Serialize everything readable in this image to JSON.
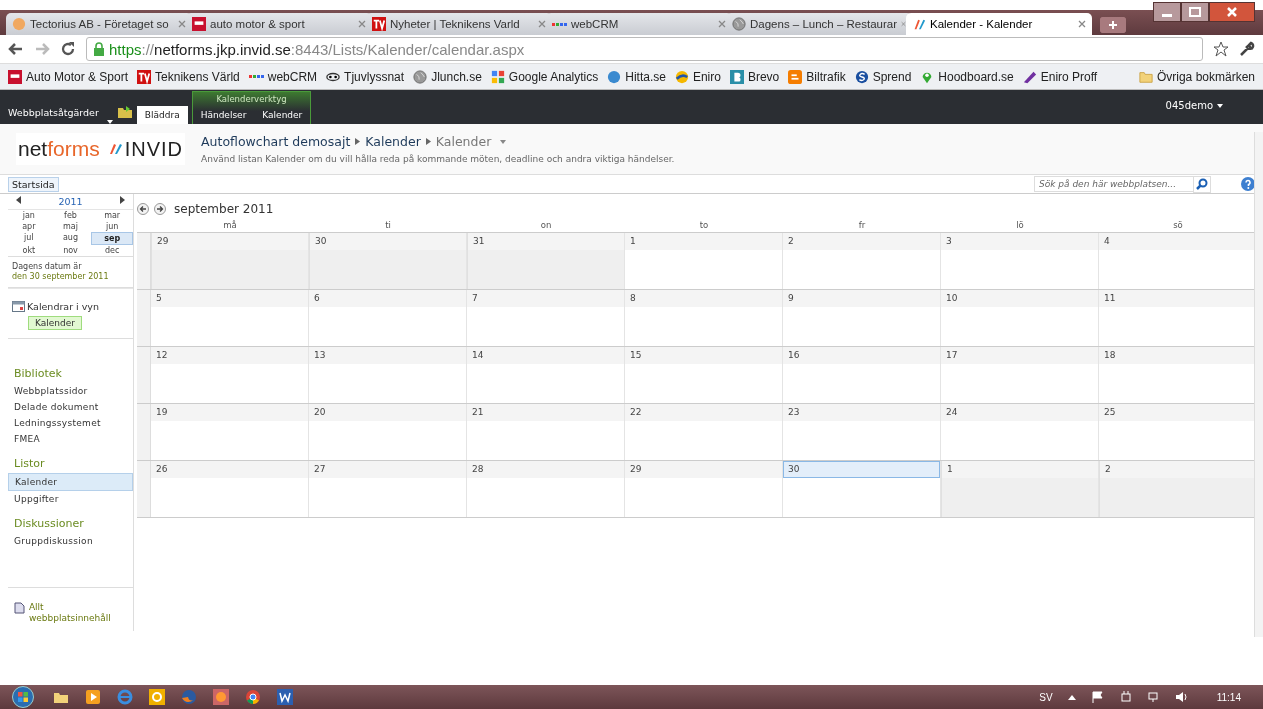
{
  "browser": {
    "tabs": [
      {
        "title": "Tectorius AB - Företaget so",
        "selected": false
      },
      {
        "title": "auto motor & sport",
        "selected": false
      },
      {
        "title": "Nyheter | Teknikens Varld",
        "selected": false
      },
      {
        "title": "webCRM",
        "selected": false
      },
      {
        "title": "Dagens – Lunch – Restaurar",
        "selected": false
      },
      {
        "title": "Kalender - Kalender",
        "selected": true
      }
    ],
    "url": {
      "scheme": "https",
      "rest": "://",
      "host": "netforms.jkp.invid.se",
      "path": ":8443/Lists/Kalender/calendar.aspx"
    },
    "bookmarks": [
      "Auto Motor & Sport",
      "Teknikens Värld",
      "webCRM",
      "Tjuvlyssnat",
      "Jlunch.se",
      "Google Analytics",
      "Hitta.se",
      "Eniro",
      "Brevo",
      "Biltrafik",
      "Sprend",
      "Hoodboard.se",
      "Eniro Proff"
    ],
    "other_bookmarks": "Övriga bokmärken"
  },
  "ribbon": {
    "site_actions": "Webbplatsåtgärder",
    "tabs": [
      {
        "label": "Bläddra",
        "selected": true
      }
    ],
    "tool_group": {
      "label": "Kalenderverktyg",
      "tabs": [
        {
          "label": "Händelser",
          "selected": false
        },
        {
          "label": "Kalender",
          "selected": false
        }
      ]
    },
    "user": "045demo"
  },
  "header": {
    "logo_dark": "net",
    "logo_accent": "forms",
    "logo_brand": "INVID",
    "breadcrumb": [
      "Autoflowchart demosajt",
      "Kalender",
      "Kalender"
    ],
    "description": "Använd listan Kalender om du vill hålla reda på kommande möten, deadline och andra viktiga händelser."
  },
  "top_nav": [
    {
      "label": "Startsida",
      "selected": true
    }
  ],
  "search": {
    "placeholder": "Sök på den här webbplatsen..."
  },
  "date_picker": {
    "year": "2011",
    "months": [
      {
        "label": "jan",
        "selected": false
      },
      {
        "label": "feb",
        "selected": false
      },
      {
        "label": "mar",
        "selected": false
      },
      {
        "label": "apr",
        "selected": false
      },
      {
        "label": "maj",
        "selected": false
      },
      {
        "label": "jun",
        "selected": false
      },
      {
        "label": "jul",
        "selected": false
      },
      {
        "label": "aug",
        "selected": false
      },
      {
        "label": "sep",
        "selected": true
      },
      {
        "label": "okt",
        "selected": false
      },
      {
        "label": "nov",
        "selected": false
      },
      {
        "label": "dec",
        "selected": false
      }
    ],
    "today_text": "Dagens datum är",
    "today_link": "den 30 september 2011"
  },
  "calendars_in_view": {
    "title": "Kalendrar i vyn",
    "items": [
      "Kalender"
    ]
  },
  "quick_launch": [
    {
      "heading": "Bibliotek",
      "items": [
        {
          "label": "Webbplatssidor",
          "selected": false
        },
        {
          "label": "Delade dokument",
          "selected": false
        },
        {
          "label": "Ledningssystemet",
          "selected": false
        },
        {
          "label": "FMEA",
          "selected": false
        }
      ]
    },
    {
      "heading": "Listor",
      "items": [
        {
          "label": "Kalender",
          "selected": true
        },
        {
          "label": "Uppgifter",
          "selected": false
        }
      ]
    },
    {
      "heading": "Diskussioner",
      "items": [
        {
          "label": "Gruppdiskussion",
          "selected": false
        }
      ]
    }
  ],
  "all_content": "Allt webbplatsinnehåll",
  "calendar": {
    "title": "september 2011",
    "weekdays": [
      "må",
      "ti",
      "on",
      "to",
      "fr",
      "lö",
      "sö"
    ],
    "weeks": [
      [
        {
          "day": "29",
          "current_month": false,
          "today": false
        },
        {
          "day": "30",
          "current_month": false,
          "today": false
        },
        {
          "day": "31",
          "current_month": false,
          "today": false
        },
        {
          "day": "1",
          "current_month": true,
          "today": false
        },
        {
          "day": "2",
          "current_month": true,
          "today": false
        },
        {
          "day": "3",
          "current_month": true,
          "today": false
        },
        {
          "day": "4",
          "current_month": true,
          "today": false
        }
      ],
      [
        {
          "day": "5",
          "current_month": true,
          "today": false
        },
        {
          "day": "6",
          "current_month": true,
          "today": false
        },
        {
          "day": "7",
          "current_month": true,
          "today": false
        },
        {
          "day": "8",
          "current_month": true,
          "today": false
        },
        {
          "day": "9",
          "current_month": true,
          "today": false
        },
        {
          "day": "10",
          "current_month": true,
          "today": false
        },
        {
          "day": "11",
          "current_month": true,
          "today": false
        }
      ],
      [
        {
          "day": "12",
          "current_month": true,
          "today": false
        },
        {
          "day": "13",
          "current_month": true,
          "today": false
        },
        {
          "day": "14",
          "current_month": true,
          "today": false
        },
        {
          "day": "15",
          "current_month": true,
          "today": false
        },
        {
          "day": "16",
          "current_month": true,
          "today": false
        },
        {
          "day": "17",
          "current_month": true,
          "today": false
        },
        {
          "day": "18",
          "current_month": true,
          "today": false
        }
      ],
      [
        {
          "day": "19",
          "current_month": true,
          "today": false
        },
        {
          "day": "20",
          "current_month": true,
          "today": false
        },
        {
          "day": "21",
          "current_month": true,
          "today": false
        },
        {
          "day": "22",
          "current_month": true,
          "today": false
        },
        {
          "day": "23",
          "current_month": true,
          "today": false
        },
        {
          "day": "24",
          "current_month": true,
          "today": false
        },
        {
          "day": "25",
          "current_month": true,
          "today": false
        }
      ],
      [
        {
          "day": "26",
          "current_month": true,
          "today": false
        },
        {
          "day": "27",
          "current_month": true,
          "today": false
        },
        {
          "day": "28",
          "current_month": true,
          "today": false
        },
        {
          "day": "29",
          "current_month": true,
          "today": false
        },
        {
          "day": "30",
          "current_month": true,
          "today": true
        },
        {
          "day": "1",
          "current_month": false,
          "today": false
        },
        {
          "day": "2",
          "current_month": false,
          "today": false
        }
      ]
    ]
  },
  "taskbar": {
    "language": "SV",
    "clock": "11:14"
  }
}
